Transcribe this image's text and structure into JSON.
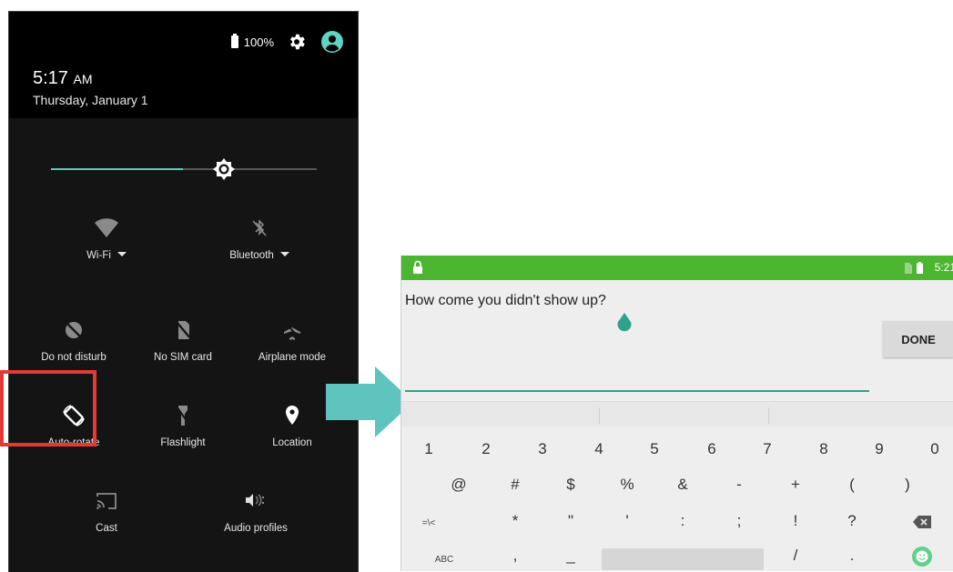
{
  "quick_settings": {
    "battery": "100%",
    "time": "5:17",
    "ampm": "AM",
    "date": "Thursday, January 1",
    "brightness": 0.5,
    "tiles": [
      {
        "label": "Wi-Fi",
        "icon": "wifi-icon",
        "dropdown": true
      },
      {
        "label": "Bluetooth",
        "icon": "bluetooth-off-icon",
        "dropdown": true
      },
      {
        "label": "Do not disturb",
        "icon": "do-not-disturb-off-icon"
      },
      {
        "label": "No SIM card",
        "icon": "no-sim-icon"
      },
      {
        "label": "Airplane mode",
        "icon": "airplane-off-icon"
      },
      {
        "label": "Auto-rotate",
        "icon": "auto-rotate-icon"
      },
      {
        "label": "Flashlight",
        "icon": "flashlight-off-icon"
      },
      {
        "label": "Location",
        "icon": "location-pin-icon"
      },
      {
        "label": "Cast",
        "icon": "cast-icon"
      },
      {
        "label": "Audio profiles",
        "icon": "audio-profiles-icon"
      }
    ],
    "highlight_color": "#e53935"
  },
  "arrow_color": "#5fc4bd",
  "tablet": {
    "status_bar_color": "#4cb630",
    "time": "5:21",
    "question": "How come you didn't show up?",
    "done_label": "DONE",
    "keyboard": {
      "row1": [
        "1",
        "2",
        "3",
        "4",
        "5",
        "6",
        "7",
        "8",
        "9",
        "0"
      ],
      "row2": [
        "@",
        "#",
        "$",
        "%",
        "&",
        "-",
        "+",
        "(",
        ")"
      ],
      "row3": [
        "=\\<",
        "*",
        "\"",
        "'",
        ":",
        ";",
        "!",
        "?"
      ],
      "row4": [
        "ABC",
        ",",
        "_",
        "/",
        "."
      ]
    }
  }
}
